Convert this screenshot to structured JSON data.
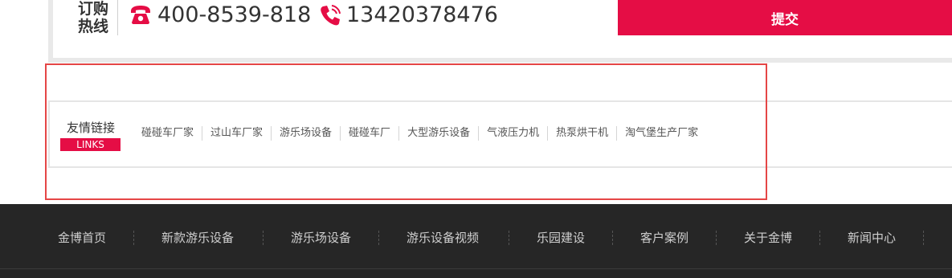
{
  "hotline": {
    "label": "订购热线",
    "phone": "400-8539-818",
    "mobile": "13420378476",
    "phone_icon": "phone-icon",
    "mobile_icon": "mobile-phone-icon"
  },
  "submit_label": "提交",
  "links": {
    "title_cn": "友情链接",
    "title_en": "LINKS",
    "items": [
      "碰碰车厂家",
      "过山车厂家",
      "游乐场设备",
      "碰碰车厂",
      "大型游乐设备",
      "气液压力机",
      "热泵烘干机",
      "淘气堡生产厂家"
    ]
  },
  "footer_nav": [
    "金博首页",
    "新款游乐设备",
    "游乐场设备",
    "游乐设备视频",
    "乐园建设",
    "客户案例",
    "关于金博",
    "新闻中心"
  ],
  "colors": {
    "accent": "#e50d45",
    "footer_bg": "#262626",
    "highlight": "#e54646"
  }
}
